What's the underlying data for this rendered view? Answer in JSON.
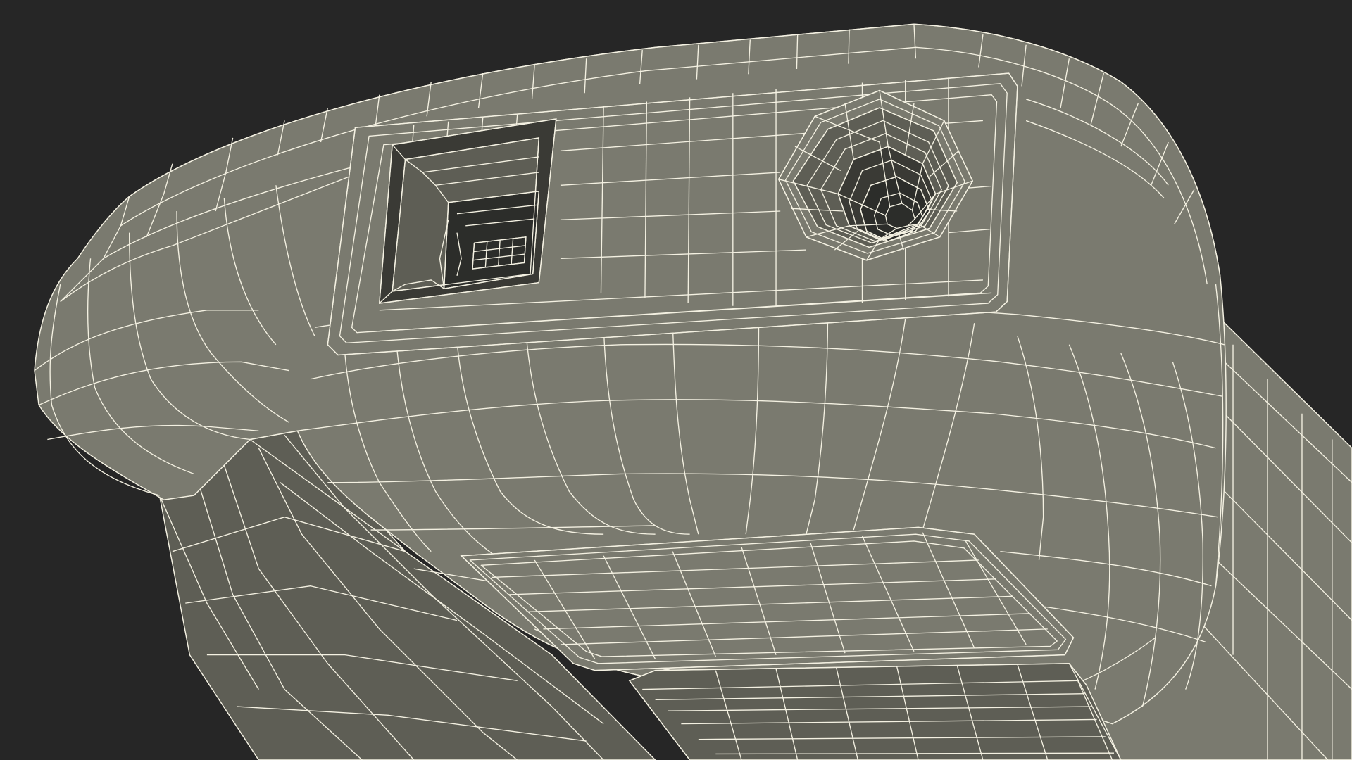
{
  "scene": {
    "background_color": "#262626",
    "body_color": "#7a7a6f",
    "body_shade_color": "#5e5e55",
    "body_dark_color": "#3a3a35",
    "recess_color": "#2c2d2a",
    "wire_color": "#f4f1e2",
    "subject": "3d-wireframe-barcode-scanner-underside"
  }
}
